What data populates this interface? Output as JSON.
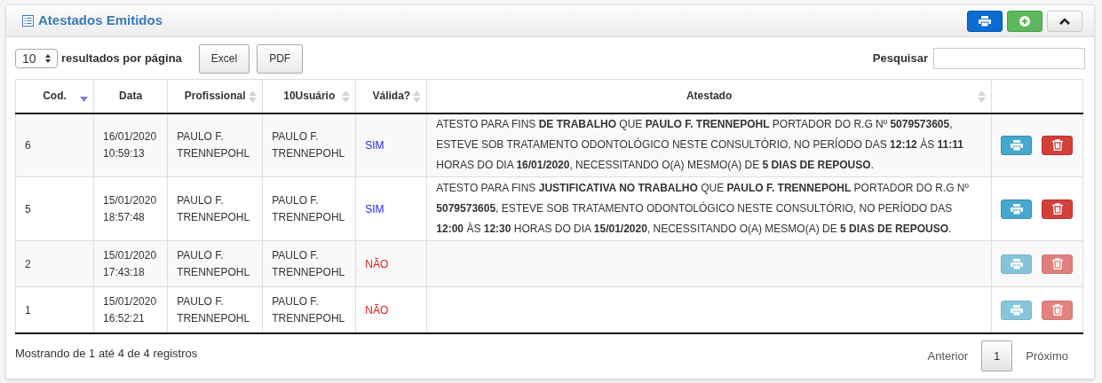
{
  "panel": {
    "title": "Atestados Emitidos"
  },
  "toolbar": {
    "page_size": "10",
    "page_size_label": "resultados por página",
    "exports": [
      "Excel",
      "PDF"
    ],
    "search_label": "Pesquisar"
  },
  "table": {
    "columns": [
      {
        "label": "Cod.",
        "sortable": true,
        "sorted": true
      },
      {
        "label": "Data",
        "sortable": false
      },
      {
        "label": "Profissional",
        "sortable": true,
        "sorted": false
      },
      {
        "label": "10Usuário",
        "sortable": true,
        "sorted": false
      },
      {
        "label": "Válida?",
        "sortable": true,
        "sorted": false
      },
      {
        "label": "Atestado",
        "sortable": true,
        "sorted": false
      }
    ],
    "rows": [
      {
        "cod": "6",
        "date": "16/01/2020",
        "time": "10:59:13",
        "profissional": "PAULO F. TRENNEPOHL",
        "usuario": "PAULO F. TRENNEPOHL",
        "valid": true,
        "valid_text": "SIM",
        "atestado": "ATESTO PARA FINS **DE TRABALHO** QUE **PAULO F. TRENNEPOHL** PORTADOR DO R.G Nº **5079573605**, ESTEVE SOB TRATAMENTO ODONTOLÓGICO NESTE CONSULTÓRIO, NO PERÍODO DAS **12:12** ÀS **11:11** HORAS DO DIA **16/01/2020**, NECESSITANDO O(A) MESMO(A) DE **5 DIAS DE REPOUSO**.",
        "actions_disabled": false
      },
      {
        "cod": "5",
        "date": "15/01/2020",
        "time": "18:57:48",
        "profissional": "PAULO F. TRENNEPOHL",
        "usuario": "PAULO F. TRENNEPOHL",
        "valid": true,
        "valid_text": "SIM",
        "atestado": "ATESTO PARA FINS **JUSTIFICATIVA NO TRABALHO** QUE **PAULO F. TRENNEPOHL** PORTADOR DO R.G Nº **5079573605**, ESTEVE SOB TRATAMENTO ODONTOLÓGICO NESTE CONSULTÓRIO, NO PERÍODO DAS **12:00** ÀS **12:30** HORAS DO DIA **15/01/2020**, NECESSITANDO O(A) MESMO(A) DE **5 DIAS DE REPOUSO**.",
        "actions_disabled": false
      },
      {
        "cod": "2",
        "date": "15/01/2020",
        "time": "17:43:18",
        "profissional": "PAULO F. TRENNEPOHL",
        "usuario": "PAULO F. TRENNEPOHL",
        "valid": false,
        "valid_text": "NÃO",
        "actions_disabled": true
      },
      {
        "cod": "1",
        "date": "15/01/2020",
        "time": "16:52:21",
        "profissional": "PAULO F. TRENNEPOHL",
        "usuario": "PAULO F. TRENNEPOHL",
        "valid": false,
        "valid_text": "NÃO",
        "actions_disabled": true
      }
    ]
  },
  "footer": {
    "info": "Mostrando de 1 até 4 de 4 registros",
    "pagination": [
      {
        "label": "Anterior",
        "selected": false
      },
      {
        "label": "1",
        "selected": true
      },
      {
        "label": "Próximo",
        "selected": false
      }
    ]
  }
}
